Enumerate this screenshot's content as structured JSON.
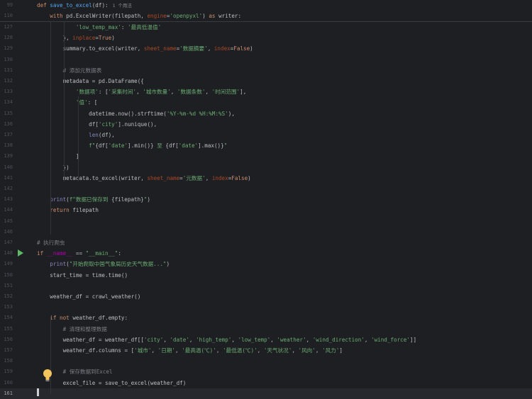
{
  "sticky": [
    {
      "num": "99",
      "segs": [
        {
          "t": "def ",
          "c": "kw"
        },
        {
          "t": "save_to_excel",
          "c": "fn"
        },
        {
          "t": "(df):",
          "c": ""
        }
      ],
      "hint": "1 个用法"
    },
    {
      "num": "110",
      "segs": [
        {
          "t": "    "
        },
        {
          "t": "with ",
          "c": "kw"
        },
        {
          "t": "pd.ExcelWriter(filepath, "
        },
        {
          "t": "engine",
          "c": "param"
        },
        {
          "t": "="
        },
        {
          "t": "'openpyxl'",
          "c": "str"
        },
        {
          "t": ") "
        },
        {
          "t": "as ",
          "c": "kw"
        },
        {
          "t": "writer:"
        }
      ]
    }
  ],
  "lines": [
    {
      "num": "127",
      "segs": [
        {
          "t": "            "
        },
        {
          "t": "'low_temp_max'",
          "c": "str"
        },
        {
          "t": ": "
        },
        {
          "t": "'最高低温值'",
          "c": "str"
        }
      ]
    },
    {
      "num": "128",
      "segs": [
        {
          "t": "        }, "
        },
        {
          "t": "inplace",
          "c": "param"
        },
        {
          "t": "="
        },
        {
          "t": "True",
          "c": "kw"
        },
        {
          "t": ")"
        }
      ]
    },
    {
      "num": "129",
      "segs": [
        {
          "t": "        summary.to_excel(writer, "
        },
        {
          "t": "sheet_name",
          "c": "param"
        },
        {
          "t": "="
        },
        {
          "t": "'数据摘要'",
          "c": "str"
        },
        {
          "t": ", "
        },
        {
          "t": "index",
          "c": "param"
        },
        {
          "t": "="
        },
        {
          "t": "False",
          "c": "kw"
        },
        {
          "t": ")"
        }
      ]
    },
    {
      "num": "130",
      "segs": []
    },
    {
      "num": "131",
      "segs": [
        {
          "t": "        "
        },
        {
          "t": "# 添加元数据表",
          "c": "cmt"
        }
      ]
    },
    {
      "num": "132",
      "segs": [
        {
          "t": "        metadata = pd.DataFrame({"
        }
      ]
    },
    {
      "num": "133",
      "segs": [
        {
          "t": "            "
        },
        {
          "t": "'数据项'",
          "c": "str"
        },
        {
          "t": ": ["
        },
        {
          "t": "'采集时间'",
          "c": "str"
        },
        {
          "t": ", "
        },
        {
          "t": "'城市数量'",
          "c": "str"
        },
        {
          "t": ", "
        },
        {
          "t": "'数据条数'",
          "c": "str"
        },
        {
          "t": ", "
        },
        {
          "t": "'时间范围'",
          "c": "str"
        },
        {
          "t": "],"
        }
      ]
    },
    {
      "num": "134",
      "segs": [
        {
          "t": "            "
        },
        {
          "t": "'值'",
          "c": "str"
        },
        {
          "t": ": ["
        }
      ]
    },
    {
      "num": "135",
      "segs": [
        {
          "t": "                datetime.now().strftime("
        },
        {
          "t": "'%Y-%m-%d %H:%M:%S'",
          "c": "str"
        },
        {
          "t": "),"
        }
      ]
    },
    {
      "num": "136",
      "segs": [
        {
          "t": "                df["
        },
        {
          "t": "'city'",
          "c": "str"
        },
        {
          "t": "].nunique(),"
        }
      ]
    },
    {
      "num": "137",
      "segs": [
        {
          "t": "                "
        },
        {
          "t": "len",
          "c": "bi"
        },
        {
          "t": "(df),"
        }
      ]
    },
    {
      "num": "138",
      "segs": [
        {
          "t": "                "
        },
        {
          "t": "f\"",
          "c": "str"
        },
        {
          "t": "{df["
        },
        {
          "t": "'date'",
          "c": "str"
        },
        {
          "t": "].min()}"
        },
        {
          "t": " 至 ",
          "c": "str"
        },
        {
          "t": "{df["
        },
        {
          "t": "'date'",
          "c": "str"
        },
        {
          "t": "].max()}"
        },
        {
          "t": "\"",
          "c": "str"
        }
      ]
    },
    {
      "num": "139",
      "segs": [
        {
          "t": "            ]"
        }
      ]
    },
    {
      "num": "140",
      "segs": [
        {
          "t": "        })"
        }
      ]
    },
    {
      "num": "141",
      "segs": [
        {
          "t": "        metadata.to_excel(writer, "
        },
        {
          "t": "sheet_name",
          "c": "param"
        },
        {
          "t": "="
        },
        {
          "t": "'元数据'",
          "c": "str"
        },
        {
          "t": ", "
        },
        {
          "t": "index",
          "c": "param"
        },
        {
          "t": "="
        },
        {
          "t": "False",
          "c": "kw"
        },
        {
          "t": ")"
        }
      ]
    },
    {
      "num": "142",
      "segs": []
    },
    {
      "num": "143",
      "segs": [
        {
          "t": "    "
        },
        {
          "t": "print",
          "c": "bi"
        },
        {
          "t": "("
        },
        {
          "t": "f\"数据已保存到 ",
          "c": "str"
        },
        {
          "t": "{filepath}"
        },
        {
          "t": "\"",
          "c": "str"
        },
        {
          "t": ")"
        }
      ]
    },
    {
      "num": "144",
      "segs": [
        {
          "t": "    "
        },
        {
          "t": "return ",
          "c": "kw"
        },
        {
          "t": "filepath"
        }
      ]
    },
    {
      "num": "145",
      "segs": []
    },
    {
      "num": "146",
      "segs": []
    },
    {
      "num": "147",
      "segs": [
        {
          "t": "# 执行爬虫",
          "c": "cmt"
        }
      ]
    },
    {
      "num": "148",
      "segs": [
        {
          "t": "if ",
          "c": "kw"
        },
        {
          "t": "__name__",
          "c": "dunder"
        },
        {
          "t": " == "
        },
        {
          "t": "\"__main__\"",
          "c": "str"
        },
        {
          "t": ":"
        }
      ],
      "run": true
    },
    {
      "num": "149",
      "segs": [
        {
          "t": "    "
        },
        {
          "t": "print",
          "c": "bi"
        },
        {
          "t": "("
        },
        {
          "t": "\"开始爬取中国气象局历史天气数据...\"",
          "c": "str"
        },
        {
          "t": ")"
        }
      ]
    },
    {
      "num": "150",
      "segs": [
        {
          "t": "    start_time = time.time()"
        }
      ]
    },
    {
      "num": "151",
      "segs": []
    },
    {
      "num": "152",
      "segs": [
        {
          "t": "    weather_df = crawl_weather()"
        }
      ]
    },
    {
      "num": "153",
      "segs": []
    },
    {
      "num": "154",
      "segs": [
        {
          "t": "    "
        },
        {
          "t": "if not ",
          "c": "kw"
        },
        {
          "t": "weather_df.empty:"
        }
      ]
    },
    {
      "num": "155",
      "segs": [
        {
          "t": "        "
        },
        {
          "t": "# 清理和整理数据",
          "c": "cmt"
        }
      ]
    },
    {
      "num": "156",
      "segs": [
        {
          "t": "        weather_df = weather_df[["
        },
        {
          "t": "'city'",
          "c": "str"
        },
        {
          "t": ", "
        },
        {
          "t": "'date'",
          "c": "str"
        },
        {
          "t": ", "
        },
        {
          "t": "'high_temp'",
          "c": "str"
        },
        {
          "t": ", "
        },
        {
          "t": "'low_temp'",
          "c": "str"
        },
        {
          "t": ", "
        },
        {
          "t": "'weather'",
          "c": "str"
        },
        {
          "t": ", "
        },
        {
          "t": "'wind_direction'",
          "c": "str"
        },
        {
          "t": ", "
        },
        {
          "t": "'wind_force'",
          "c": "str"
        },
        {
          "t": "]]"
        }
      ]
    },
    {
      "num": "157",
      "segs": [
        {
          "t": "        weather_df.columns = ["
        },
        {
          "t": "'城市'",
          "c": "str"
        },
        {
          "t": ", "
        },
        {
          "t": "'日期'",
          "c": "str"
        },
        {
          "t": ", "
        },
        {
          "t": "'最高温(℃)'",
          "c": "str"
        },
        {
          "t": ", "
        },
        {
          "t": "'最低温(℃)'",
          "c": "str"
        },
        {
          "t": ", "
        },
        {
          "t": "'天气状况'",
          "c": "str"
        },
        {
          "t": ", "
        },
        {
          "t": "'风向'",
          "c": "str"
        },
        {
          "t": ", "
        },
        {
          "t": "'风力'",
          "c": "str"
        },
        {
          "t": "]"
        }
      ]
    },
    {
      "num": "158",
      "segs": []
    },
    {
      "num": "159",
      "segs": [
        {
          "t": "        "
        },
        {
          "t": "# 保存数据到Excel",
          "c": "cmt"
        }
      ],
      "bulb": true
    },
    {
      "num": "160",
      "segs": [
        {
          "t": "        excel_file = save_to_excel(weather_df)"
        }
      ]
    },
    {
      "num": "161",
      "segs": [],
      "current": true
    }
  ],
  "icons": {
    "run": "run-gutter-icon",
    "bulb": "lightbulb-icon"
  }
}
